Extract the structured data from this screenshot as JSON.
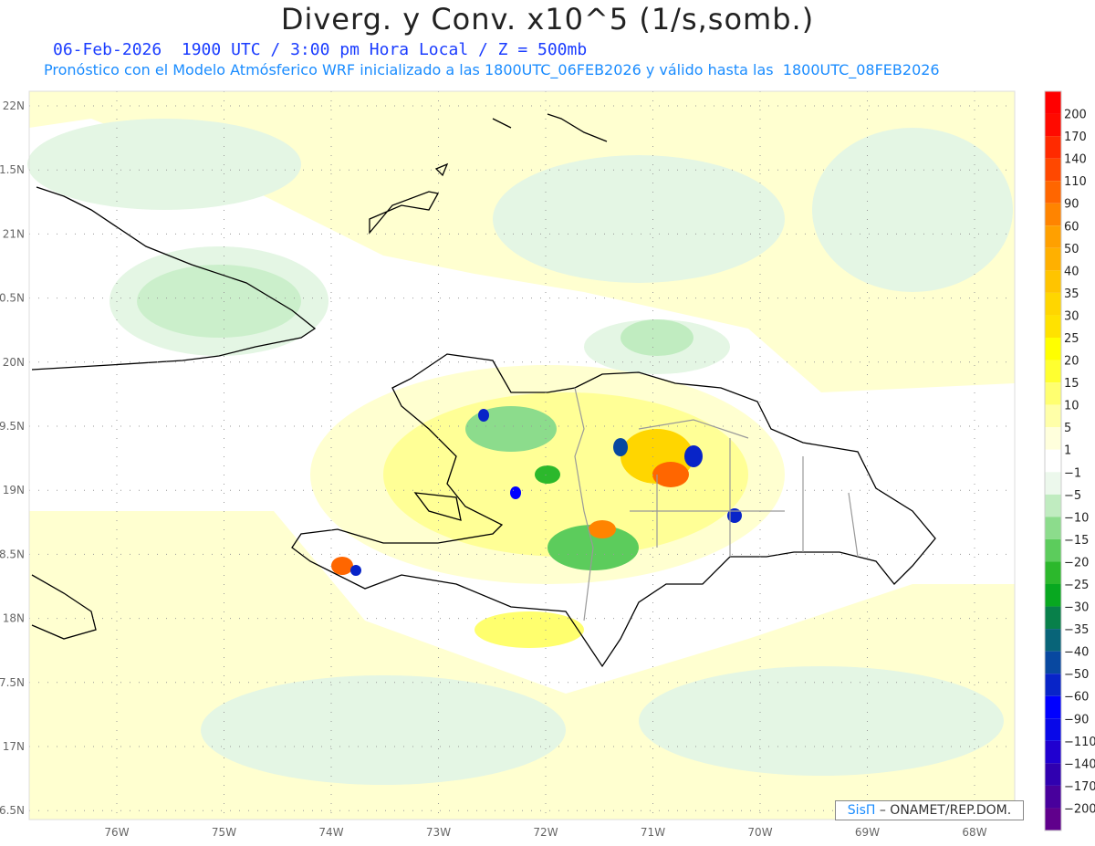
{
  "header": {
    "title": "Diverg. y Conv. x10^5 (1/s,somb.)",
    "subtitle_date": "06-Feb-2026  1900 UTC / 3:00 pm Hora Local / Z = 500mb",
    "subtitle_model": "Pronóstico con el Modelo Atmósferico WRF inicializado a las 1800UTC_06FEB2026 y válido hasta las  1800UTC_08FEB2026"
  },
  "map": {
    "lat_labels": [
      "22N",
      "1.5N",
      "21N",
      "0.5N",
      "20N",
      "9.5N",
      "19N",
      "8.5N",
      "18N",
      "7.5N",
      "17N",
      "6.5N"
    ],
    "lon_labels": [
      "76W",
      "75W",
      "74W",
      "73W",
      "72W",
      "71W",
      "70W",
      "69W",
      "68W"
    ]
  },
  "colorbar": {
    "labels": [
      "200",
      "170",
      "140",
      "110",
      "90",
      "60",
      "50",
      "40",
      "35",
      "30",
      "25",
      "20",
      "15",
      "10",
      "5",
      "1",
      "−1",
      "−5",
      "−10",
      "−15",
      "−20",
      "−25",
      "−30",
      "−35",
      "−40",
      "−50",
      "−60",
      "−90",
      "−110",
      "−140",
      "−170",
      "−200"
    ],
    "colors": [
      "#ff0000",
      "#ff0a00",
      "#ff2a00",
      "#ff4800",
      "#ff6600",
      "#ff8400",
      "#ffa000",
      "#ffb000",
      "#ffc400",
      "#ffd600",
      "#ffe200",
      "#ffff00",
      "#ffff30",
      "#ffff70",
      "#ffffa8",
      "#ffffdc",
      "#ffffff",
      "#ecf8ec",
      "#c0ecc0",
      "#8cdc8c",
      "#5ccc5c",
      "#2cb82c",
      "#08a820",
      "#08804a",
      "#086478",
      "#0848a0",
      "#0824c8",
      "#0000ff",
      "#0808e8",
      "#2000d0",
      "#3000b0",
      "#48009c",
      "#60008c"
    ]
  },
  "credit": {
    "brand": "SisΠ",
    "text": " – ONAMET/REP.DOM."
  }
}
